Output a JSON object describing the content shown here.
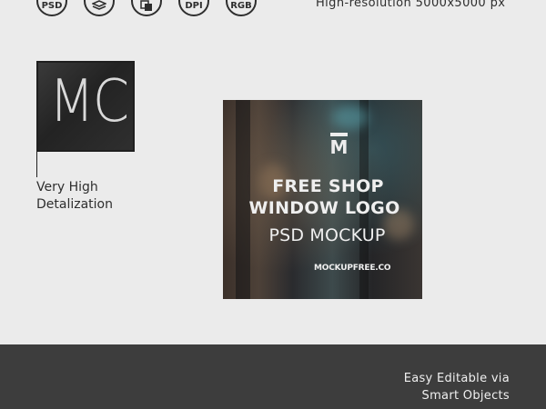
{
  "badges": [
    {
      "icon": "psd-icon",
      "label": "PSD"
    },
    {
      "icon": "layers-icon",
      "label": ""
    },
    {
      "icon": "smart-object-icon",
      "label": ""
    },
    {
      "icon": "dpi-icon",
      "label": "DPI"
    },
    {
      "icon": "rgb-icon",
      "label": "RGB"
    }
  ],
  "resolution_text": "High-resolution 5000x5000 px",
  "zoom_detail": {
    "text": "MC",
    "label": "Very High\nDetalization"
  },
  "mockup": {
    "mark": "M",
    "line1": "FREE SHOP",
    "line2": "WINDOW LOGO",
    "line3": "PSD MOCKUP",
    "line4": "MOCKUPFREE.CO"
  },
  "footer": {
    "text": "Easy Editable via\nSmart Objects",
    "background": "#3d3d3d"
  }
}
